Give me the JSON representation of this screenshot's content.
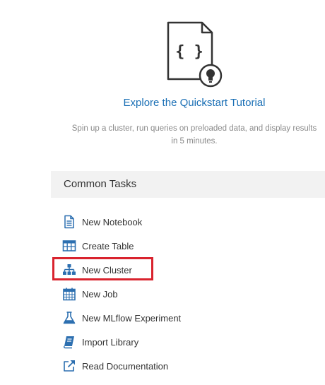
{
  "quickstart": {
    "link_text": "Explore the Quickstart Tutorial",
    "description": "Spin up a cluster, run queries on preloaded data, and display results in 5 minutes.",
    "icon": "notebook-lightbulb-icon"
  },
  "common_tasks": {
    "title": "Common Tasks",
    "items": [
      {
        "label": "New Notebook",
        "icon": "notebook-icon"
      },
      {
        "label": "Create Table",
        "icon": "table-icon"
      },
      {
        "label": "New Cluster",
        "icon": "cluster-icon",
        "highlighted": true
      },
      {
        "label": "New Job",
        "icon": "calendar-icon"
      },
      {
        "label": "New MLflow Experiment",
        "icon": "flask-icon"
      },
      {
        "label": "Import Library",
        "icon": "library-icon"
      },
      {
        "label": "Read Documentation",
        "icon": "external-link-icon"
      }
    ]
  },
  "colors": {
    "accent": "#1a6fb5",
    "icon": "#2c6fb0",
    "highlight": "#d9232e",
    "panel": "#f2f2f2"
  }
}
